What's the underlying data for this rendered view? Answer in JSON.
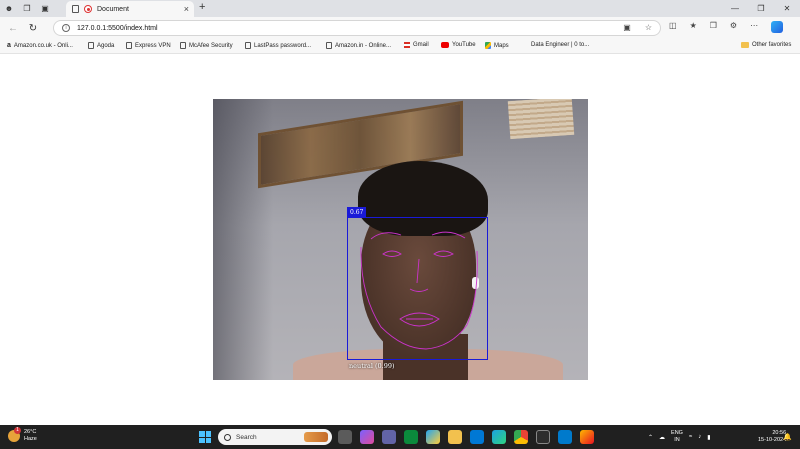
{
  "browser": {
    "tab_title": "Document",
    "url": "127.0.0.1:5500/index.html",
    "bookmarks": [
      {
        "label": "Amazon.co.uk - Onli...",
        "icon": "amazon-icon"
      },
      {
        "label": "Agoda",
        "icon": "page-icon"
      },
      {
        "label": "Express VPN",
        "icon": "page-icon"
      },
      {
        "label": "McAfee Security",
        "icon": "page-icon"
      },
      {
        "label": "LastPass password...",
        "icon": "page-icon"
      },
      {
        "label": "Amazon.in - Online...",
        "icon": "page-icon"
      },
      {
        "label": "Gmail",
        "icon": "gmail-icon"
      },
      {
        "label": "YouTube",
        "icon": "youtube-icon"
      },
      {
        "label": "Maps",
        "icon": "maps-icon"
      },
      {
        "label": "Data Engineer | 0 to...",
        "icon": "blank-icon"
      }
    ],
    "other_favorites": "Other favorites"
  },
  "detection": {
    "score": "0.67",
    "expression": "neutral (0.99)",
    "box_color": "#1a1ad8",
    "landmark_color": "#cc33cc"
  },
  "taskbar": {
    "temperature": "26°C",
    "weather": "Haze",
    "weather_badge": "1",
    "search_placeholder": "Search",
    "lang_top": "ENG",
    "lang_bottom": "IN",
    "time": "20:56",
    "date": "15-10-2024"
  }
}
